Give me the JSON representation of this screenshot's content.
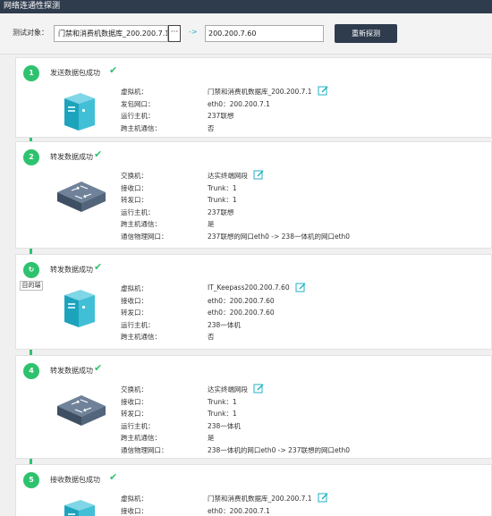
{
  "window": {
    "title": "网络连通性探测"
  },
  "toolbar": {
    "label": "测试对象：",
    "source_value": "门禁和消费机数据库_200.200.7.1",
    "dots": "···",
    "arrow": "->",
    "target_value": "200.200.7.60",
    "redetect_label": "重新探测"
  },
  "goal_tag": "目的端",
  "steps": [
    {
      "num": "1",
      "title": "发送数据包成功",
      "device": "server",
      "rows": [
        {
          "label": "虚拟机：",
          "value": "门禁和消费机数据库_200.200.7.1",
          "editable": true
        },
        {
          "label": "发包网口：",
          "value": "eth0：200.200.7.1"
        },
        {
          "label": "运行主机：",
          "value": "237联想"
        },
        {
          "label": "跨主机通信：",
          "value": "否"
        }
      ]
    },
    {
      "num": "2",
      "title": "转发数据成功",
      "device": "switch",
      "rows": [
        {
          "label": "交换机：",
          "value": "达实终端网段",
          "editable": true
        },
        {
          "label": "接收口：",
          "value": "Trunk：1"
        },
        {
          "label": "转发口：",
          "value": "Trunk：1"
        },
        {
          "label": "运行主机：",
          "value": "237联想"
        },
        {
          "label": "跨主机通信：",
          "value": "是"
        },
        {
          "label": "通信物理网口：",
          "value": "237联想的网口eth0 -> 238一体机的网口eth0"
        }
      ]
    },
    {
      "num": "↻",
      "title": "转发数据成功",
      "device": "server",
      "rows": [
        {
          "label": "虚拟机：",
          "value": "IT_Keepass200.200.7.60",
          "editable": true
        },
        {
          "label": "接收口：",
          "value": "eth0：200.200.7.60"
        },
        {
          "label": "转发口：",
          "value": "eth0：200.200.7.60"
        },
        {
          "label": "运行主机：",
          "value": "238一体机"
        },
        {
          "label": "跨主机通信：",
          "value": "否"
        }
      ]
    },
    {
      "num": "4",
      "title": "转发数据成功",
      "device": "switch",
      "rows": [
        {
          "label": "交换机：",
          "value": "达实终端网段",
          "editable": true
        },
        {
          "label": "接收口：",
          "value": "Trunk：1"
        },
        {
          "label": "转发口：",
          "value": "Trunk：1"
        },
        {
          "label": "运行主机：",
          "value": "238一体机"
        },
        {
          "label": "跨主机通信：",
          "value": "是"
        },
        {
          "label": "通信物理网口：",
          "value": "238一体机的网口eth0 -> 237联想的网口eth0"
        }
      ]
    },
    {
      "num": "5",
      "title": "接收数据包成功",
      "device": "server",
      "rows": [
        {
          "label": "虚拟机：",
          "value": "门禁和消费机数据库_200.200.7.1",
          "editable": true
        },
        {
          "label": "接收口：",
          "value": "eth0：200.200.7.1"
        }
      ]
    }
  ],
  "colors": {
    "accent": "#2ec26e",
    "header": "#2f3c4e",
    "link": "#1fb0c5"
  }
}
